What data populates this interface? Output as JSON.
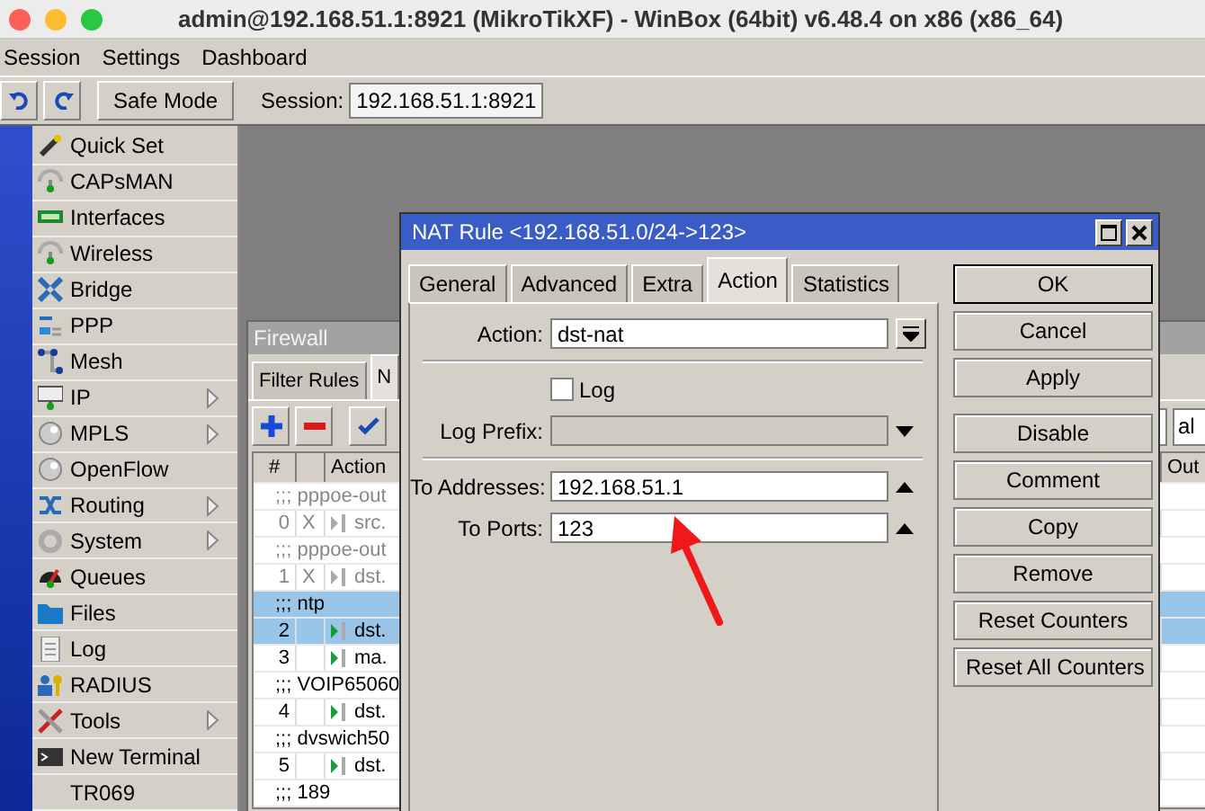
{
  "window": {
    "title": "admin@192.168.51.1:8921 (MikroTikXF) - WinBox (64bit) v6.48.4 on x86 (x86_64)"
  },
  "menu": [
    "Session",
    "Settings",
    "Dashboard"
  ],
  "toolbar": {
    "safe_mode": "Safe Mode",
    "session_label": "Session:",
    "session_value": "192.168.51.1:8921"
  },
  "sidebar": {
    "items": [
      {
        "label": "Quick Set",
        "submenu": false
      },
      {
        "label": "CAPsMAN",
        "submenu": false
      },
      {
        "label": "Interfaces",
        "submenu": false
      },
      {
        "label": "Wireless",
        "submenu": false
      },
      {
        "label": "Bridge",
        "submenu": false
      },
      {
        "label": "PPP",
        "submenu": false
      },
      {
        "label": "Mesh",
        "submenu": false
      },
      {
        "label": "IP",
        "submenu": true
      },
      {
        "label": "MPLS",
        "submenu": true
      },
      {
        "label": "OpenFlow",
        "submenu": false
      },
      {
        "label": "Routing",
        "submenu": true
      },
      {
        "label": "System",
        "submenu": true
      },
      {
        "label": "Queues",
        "submenu": false
      },
      {
        "label": "Files",
        "submenu": false
      },
      {
        "label": "Log",
        "submenu": false
      },
      {
        "label": "RADIUS",
        "submenu": false
      },
      {
        "label": "Tools",
        "submenu": true
      },
      {
        "label": "New Terminal",
        "submenu": false
      },
      {
        "label": "TR069",
        "submenu": false
      }
    ]
  },
  "firewall": {
    "title": "Firewall",
    "tabs": [
      {
        "label": "Filter Rules",
        "selected": false
      },
      {
        "label": "N",
        "selected": true
      }
    ],
    "filter_value": "al",
    "columns": [
      "#",
      "Action",
      "Out"
    ],
    "rows": [
      {
        "kind": "comment",
        "text": ";;; pppoe-out",
        "disabled": true,
        "selected": false
      },
      {
        "kind": "rule",
        "number": "0",
        "flag": "X",
        "action": "src.",
        "disabled": true,
        "selected": false
      },
      {
        "kind": "comment",
        "text": ";;; pppoe-out",
        "disabled": true,
        "selected": false
      },
      {
        "kind": "rule",
        "number": "1",
        "flag": "X",
        "action": "dst.",
        "disabled": true,
        "selected": false
      },
      {
        "kind": "comment",
        "text": ";;; ntp",
        "disabled": false,
        "selected": true
      },
      {
        "kind": "rule",
        "number": "2",
        "action": "dst.",
        "disabled": false,
        "selected": true
      },
      {
        "kind": "rule",
        "number": "3",
        "action": "ma.",
        "disabled": false,
        "selected": false
      },
      {
        "kind": "comment",
        "text": ";;; VOIP65060",
        "disabled": false,
        "selected": false
      },
      {
        "kind": "rule",
        "number": "4",
        "action": "dst.",
        "disabled": false,
        "selected": false
      },
      {
        "kind": "comment",
        "text": ";;; dvswich50",
        "disabled": false,
        "selected": false
      },
      {
        "kind": "rule",
        "number": "5",
        "action": "dst.",
        "disabled": false,
        "selected": false
      },
      {
        "kind": "comment",
        "text": ";;; 189",
        "disabled": false,
        "selected": false
      }
    ]
  },
  "nat_rule": {
    "title": "NAT Rule <192.168.51.0/24->123>",
    "tabs": [
      {
        "label": "General",
        "selected": false
      },
      {
        "label": "Advanced",
        "selected": false
      },
      {
        "label": "Extra",
        "selected": false
      },
      {
        "label": "Action",
        "selected": true
      },
      {
        "label": "Statistics",
        "selected": false
      }
    ],
    "fields": [
      {
        "kind": "select",
        "label": "Action:",
        "value": "dst-nat"
      },
      {
        "kind": "separator"
      },
      {
        "kind": "checkbox",
        "label": "Log",
        "checked": false
      },
      {
        "kind": "text",
        "label": "Log Prefix:",
        "disabled": true,
        "expanded": false
      },
      {
        "kind": "separator"
      },
      {
        "kind": "text",
        "label": "To Addresses:",
        "value": "192.168.51.1",
        "disabled": false,
        "expanded": true
      },
      {
        "kind": "text",
        "label": "To Ports:",
        "value": "123",
        "disabled": false,
        "expanded": true
      }
    ],
    "button_groups": [
      [
        {
          "label": "OK",
          "default": true
        },
        {
          "label": "Cancel",
          "default": false
        },
        {
          "label": "Apply",
          "default": false
        }
      ],
      [
        {
          "label": "Disable",
          "default": false
        },
        {
          "label": "Comment",
          "default": false
        },
        {
          "label": "Copy",
          "default": false
        },
        {
          "label": "Remove",
          "default": false
        },
        {
          "label": "Reset Counters",
          "default": false
        },
        {
          "label": "Reset All Counters",
          "default": false
        }
      ]
    ]
  }
}
